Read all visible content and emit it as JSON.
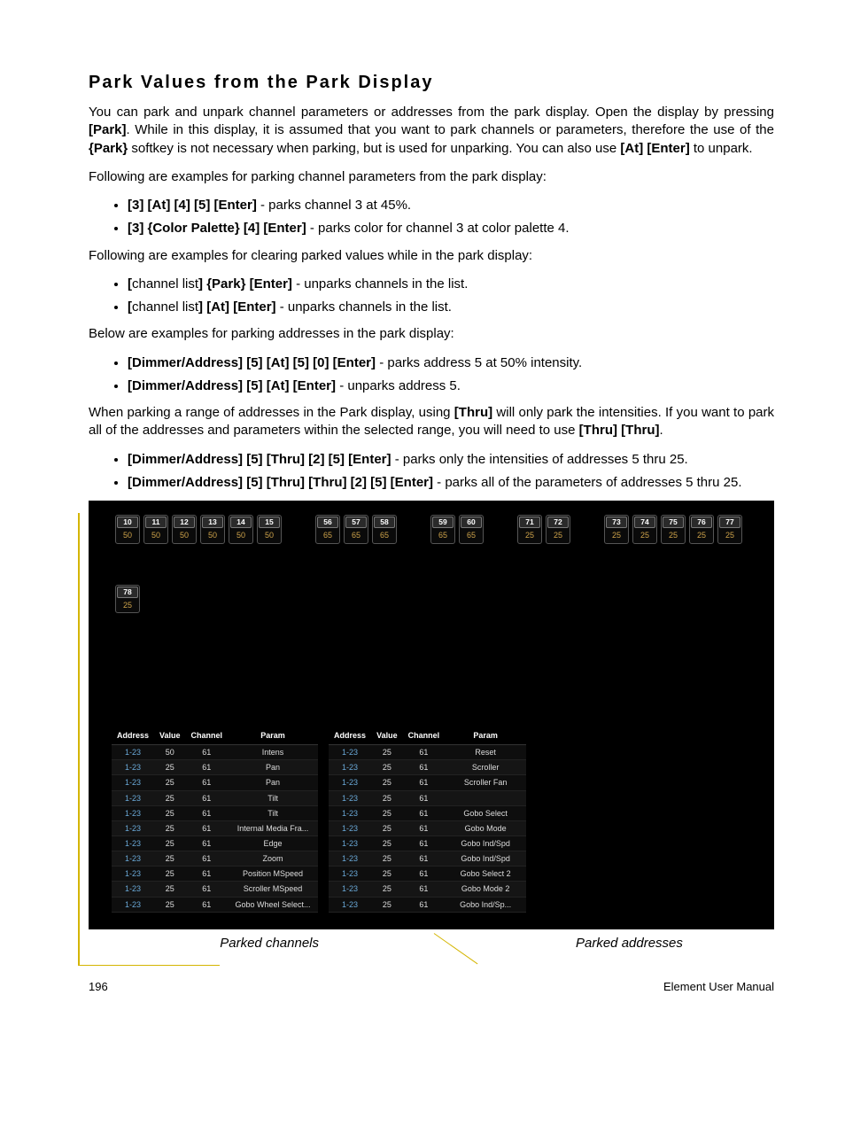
{
  "title": "Park Values from the Park Display",
  "p1a": "You can park and unpark channel parameters or addresses from the park display. Open the display by pressing ",
  "p1b": "[Park]",
  "p1c": ". While in this display, it is assumed that you want to park channels or parameters, therefore the use of the ",
  "p1d": "{Park}",
  "p1e": " softkey is not necessary when parking, but is used for unparking. You can also use ",
  "p1f": "[At] [Enter]",
  "p1g": " to unpark.",
  "p2": "Following are examples for parking channel parameters from the park display:",
  "b1a": "[3] [At] [4] [5] [Enter]",
  "b1b": " - parks channel 3 at 45%.",
  "b2a": "[3] {Color Palette} [4] [Enter]",
  "b2b": " - parks color for channel 3 at color palette 4.",
  "p3": "Following are examples for clearing parked values while in the park display:",
  "b3a": "[",
  "b3b": "channel list",
  "b3c": "] {Park} [Enter]",
  "b3d": " - unparks channels in the list.",
  "b4a": "[",
  "b4b": "channel list",
  "b4c": "] [At] [Enter]",
  "b4d": " - unparks channels in the list.",
  "p4": "Below are examples for parking addresses in the park display:",
  "b5a": "[Dimmer/Address] [5] [At] [5] [0] [Enter]",
  "b5b": " - parks address 5 at 50% intensity.",
  "b6a": "[Dimmer/Address] [5] [At] [Enter]",
  "b6b": " - unparks address 5.",
  "p5a": "When parking a range of addresses in the Park display, using ",
  "p5b": "[Thru]",
  "p5c": " will only park the intensities. If you want to park all of the addresses and parameters within the selected range, you will need to use ",
  "p5d": "[Thru] [Thru]",
  "p5e": ".",
  "b7a": "[Dimmer/Address] [5] [Thru] [2] [5] [Enter]",
  "b7b": " - parks only the intensities of addresses 5 thru 25.",
  "b8a": "[Dimmer/Address] [5] [Thru] [Thru] [2] [5] [Enter]",
  "b8b": " - parks all of the parameters of addresses 5 thru 25.",
  "cap1": "Parked channels",
  "cap2": "Parked addresses",
  "page": "196",
  "manual": "Element User Manual",
  "chan_header": {
    "address": "Address",
    "value": "Value",
    "channel": "Channel",
    "param": "Param"
  },
  "chan_row1": [
    {
      "n": "10",
      "v": "50"
    },
    {
      "n": "11",
      "v": "50"
    },
    {
      "n": "12",
      "v": "50"
    },
    {
      "n": "13",
      "v": "50"
    },
    {
      "n": "14",
      "v": "50"
    },
    {
      "n": "15",
      "v": "50"
    },
    null,
    {
      "n": "56",
      "v": "65"
    },
    {
      "n": "57",
      "v": "65"
    },
    {
      "n": "58",
      "v": "65"
    },
    null,
    {
      "n": "59",
      "v": "65"
    },
    {
      "n": "60",
      "v": "65"
    },
    null,
    {
      "n": "71",
      "v": "25"
    },
    {
      "n": "72",
      "v": "25"
    },
    null,
    {
      "n": "73",
      "v": "25"
    },
    {
      "n": "74",
      "v": "25"
    },
    {
      "n": "75",
      "v": "25"
    },
    {
      "n": "76",
      "v": "25"
    },
    {
      "n": "77",
      "v": "25"
    }
  ],
  "chan_row2": [
    {
      "n": "78",
      "v": "25"
    }
  ],
  "table1": [
    {
      "a": "1-23",
      "v": "50",
      "c": "61",
      "p": "Intens"
    },
    {
      "a": "1-23",
      "v": "25",
      "c": "61",
      "p": "Pan"
    },
    {
      "a": "1-23",
      "v": "25",
      "c": "61",
      "p": "Pan"
    },
    {
      "a": "1-23",
      "v": "25",
      "c": "61",
      "p": "Tilt"
    },
    {
      "a": "1-23",
      "v": "25",
      "c": "61",
      "p": "Tilt"
    },
    {
      "a": "1-23",
      "v": "25",
      "c": "61",
      "p": "Internal Media Fra..."
    },
    {
      "a": "1-23",
      "v": "25",
      "c": "61",
      "p": "Edge"
    },
    {
      "a": "1-23",
      "v": "25",
      "c": "61",
      "p": "Zoom"
    },
    {
      "a": "1-23",
      "v": "25",
      "c": "61",
      "p": "Position MSpeed"
    },
    {
      "a": "1-23",
      "v": "25",
      "c": "61",
      "p": "Scroller MSpeed"
    },
    {
      "a": "1-23",
      "v": "25",
      "c": "61",
      "p": "Gobo Wheel Select..."
    }
  ],
  "table2": [
    {
      "a": "1-23",
      "v": "25",
      "c": "61",
      "p": "Reset"
    },
    {
      "a": "1-23",
      "v": "25",
      "c": "61",
      "p": "Scroller"
    },
    {
      "a": "1-23",
      "v": "25",
      "c": "61",
      "p": "Scroller Fan"
    },
    {
      "a": "1-23",
      "v": "25",
      "c": "61",
      "p": ""
    },
    {
      "a": "1-23",
      "v": "25",
      "c": "61",
      "p": "Gobo Select"
    },
    {
      "a": "1-23",
      "v": "25",
      "c": "61",
      "p": "Gobo Mode"
    },
    {
      "a": "1-23",
      "v": "25",
      "c": "61",
      "p": "Gobo Ind/Spd"
    },
    {
      "a": "1-23",
      "v": "25",
      "c": "61",
      "p": "Gobo Ind/Spd"
    },
    {
      "a": "1-23",
      "v": "25",
      "c": "61",
      "p": "Gobo Select 2"
    },
    {
      "a": "1-23",
      "v": "25",
      "c": "61",
      "p": "Gobo Mode 2"
    },
    {
      "a": "1-23",
      "v": "25",
      "c": "61",
      "p": "Gobo Ind/Sp..."
    }
  ]
}
